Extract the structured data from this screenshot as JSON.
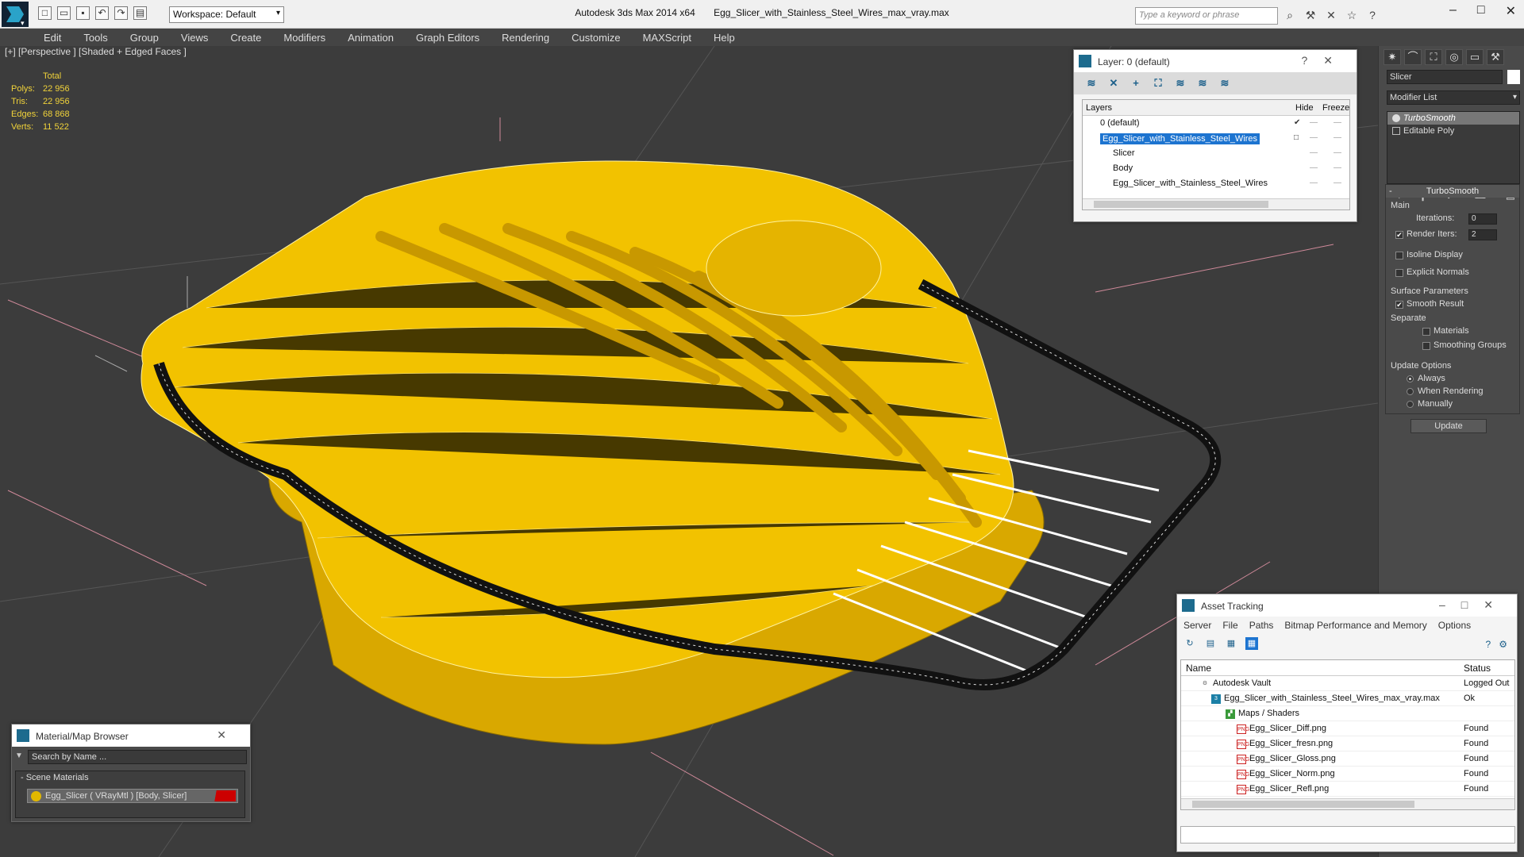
{
  "app": {
    "title": "Autodesk 3ds Max  2014 x64",
    "file": "Egg_Slicer_with_Stainless_Steel_Wires_max_vray.max",
    "workspace": "Workspace: Default",
    "search_placeholder": "Type a keyword or phrase"
  },
  "menu": [
    "Edit",
    "Tools",
    "Group",
    "Views",
    "Create",
    "Modifiers",
    "Animation",
    "Graph Editors",
    "Rendering",
    "Customize",
    "MAXScript",
    "Help"
  ],
  "viewport": {
    "label": "[+] [Perspective ] [Shaded + Edged Faces ]",
    "stats": {
      "header": "Total",
      "polys_label": "Polys:",
      "polys": "22 956",
      "tris_label": "Tris:",
      "tris": "22 956",
      "edges_label": "Edges:",
      "edges": "68 868",
      "verts_label": "Verts:",
      "verts": "11 522"
    }
  },
  "layer_window": {
    "title": "Layer: 0 (default)",
    "col_layers": "Layers",
    "col_hide": "Hide",
    "col_freeze": "Freeze",
    "rows": [
      {
        "name": "0 (default)"
      },
      {
        "name": "Egg_Slicer_with_Stainless_Steel_Wires"
      },
      {
        "name": "Slicer"
      },
      {
        "name": "Body"
      },
      {
        "name": "Egg_Slicer_with_Stainless_Steel_Wires"
      }
    ]
  },
  "command_panel": {
    "object_name": "Slicer",
    "modifier_list": "Modifier List",
    "stack": [
      "TurboSmooth",
      "Editable Poly"
    ],
    "turbosmooth": {
      "title": "TurboSmooth",
      "main": "Main",
      "iterations_label": "Iterations:",
      "iterations": "0",
      "render_iters_label": "Render Iters:",
      "render_iters": "2",
      "isoline": "Isoline Display",
      "explicit_normals": "Explicit Normals",
      "surface_params": "Surface Parameters",
      "smooth_result": "Smooth Result",
      "separate": "Separate",
      "materials": "Materials",
      "smoothing_groups": "Smoothing Groups",
      "update_options": "Update Options",
      "always": "Always",
      "when_rendering": "When Rendering",
      "manually": "Manually",
      "update": "Update"
    }
  },
  "asset_tracking": {
    "title": "Asset Tracking",
    "menu": [
      "Server",
      "File",
      "Paths",
      "Bitmap Performance and Memory",
      "Options"
    ],
    "col_name": "Name",
    "col_status": "Status",
    "rows": [
      {
        "name": "Autodesk Vault",
        "status": "Logged Out"
      },
      {
        "name": "Egg_Slicer_with_Stainless_Steel_Wires_max_vray.max",
        "status": "Ok"
      },
      {
        "name": "Maps / Shaders",
        "status": ""
      },
      {
        "name": "Egg_Slicer_Diff.png",
        "status": "Found"
      },
      {
        "name": "Egg_Slicer_fresn.png",
        "status": "Found"
      },
      {
        "name": "Egg_Slicer_Gloss.png",
        "status": "Found"
      },
      {
        "name": "Egg_Slicer_Norm.png",
        "status": "Found"
      },
      {
        "name": "Egg_Slicer_Refl.png",
        "status": "Found"
      }
    ]
  },
  "material_browser": {
    "title": "Material/Map Browser",
    "search": "Search by Name ...",
    "group": "- Scene Materials",
    "item": "Egg_Slicer  ( VRayMtl ) [Body, Slicer]"
  },
  "colors": {
    "model_yellow": "#f2c200",
    "stat_yellow": "#f1d33a",
    "selection_blue": "#1d74d0"
  }
}
